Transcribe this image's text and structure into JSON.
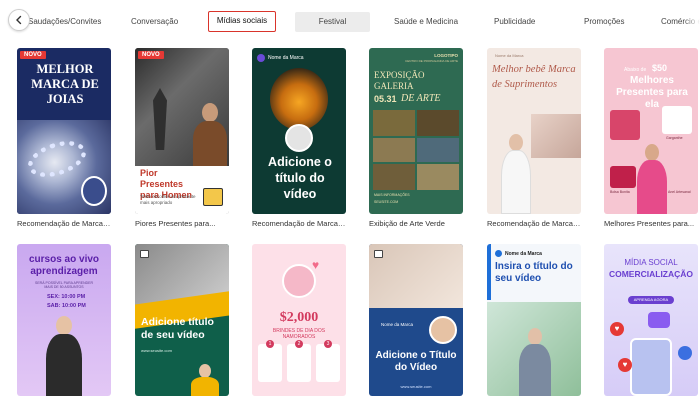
{
  "categories": [
    {
      "label": "Saudações/Convites"
    },
    {
      "label": "Conversação"
    },
    {
      "label": "Mídias sociais",
      "selected": true
    },
    {
      "label": "Festival"
    },
    {
      "label": "Saúde e Medicina"
    },
    {
      "label": "Publicidade"
    },
    {
      "label": "Promoções"
    },
    {
      "label": "Comércio el"
    }
  ],
  "icons": {
    "back": "chevron-left-icon"
  },
  "badge_label": "NOVO",
  "row1": [
    {
      "caption": "Recomendação de Marca de...",
      "title": "MELHOR MARCA DE JOIAS",
      "badge": true
    },
    {
      "caption": "Piores Presentes para...",
      "title": "Pior Presentes para Homen",
      "sub": "Tente escolher um presente mais apropriado",
      "badge": true
    },
    {
      "caption": "Recomendação de Marca d...",
      "brand": "Nome da Marca",
      "title": "Adicione o título do vídeo"
    },
    {
      "caption": "Exibição de Arte Verde",
      "logo": "LOGOTIPO",
      "logo_sub": "CENTRO DE PROPAGANDA DE ARTE",
      "title": "EXPOSIÇÃO GALERIA",
      "date": "05.31",
      "art": "DE ARTE",
      "footer1": "MAIS INFORMAÇÕES",
      "footer2": "SEUSITE.COM"
    },
    {
      "caption": "Recomendação de Marca d...",
      "brand": "Nome da Marca",
      "title": "Melhor bebê Marca de Suprimentos"
    },
    {
      "caption": "Melhores Presentes para...",
      "top": "Abaixo de",
      "price": "$50",
      "title": "Melhores Presentes para ela",
      "labels": [
        "Bolsa Bonita",
        "Garganthe",
        "Anel Artesanal"
      ]
    }
  ],
  "row2": [
    {
      "title": "cursos ao vivo aprendizagem",
      "sub1": "SERÁ POSSÍVEL PARA APRENDER MAIS DE 50 ASSUNTOS",
      "sub2": "SEX: 10:00 PM",
      "sub3": "SAB: 10:00 PM"
    },
    {
      "title": "Adicione título de seu vídeo",
      "url": "www.seusite.com"
    },
    {
      "price": "$2,000",
      "sub": "BRINDES DE DIA DOS NAMORADOS",
      "steps": [
        "1",
        "2",
        "3"
      ]
    },
    {
      "brand": "Nome da Marca",
      "title": "Adicione o Título do Vídeo",
      "url": "www.seusite.com"
    },
    {
      "brand": "Nome da Marca",
      "title": "Insira o título do seu vídeo"
    },
    {
      "top": "MÍDIA SOCIAL",
      "title": "COMERCIALIZAÇÃO",
      "cta": "APRENDA AGORA"
    }
  ],
  "colors": {
    "accent_red": "#d9342b",
    "selected_bg": "#ececec"
  }
}
